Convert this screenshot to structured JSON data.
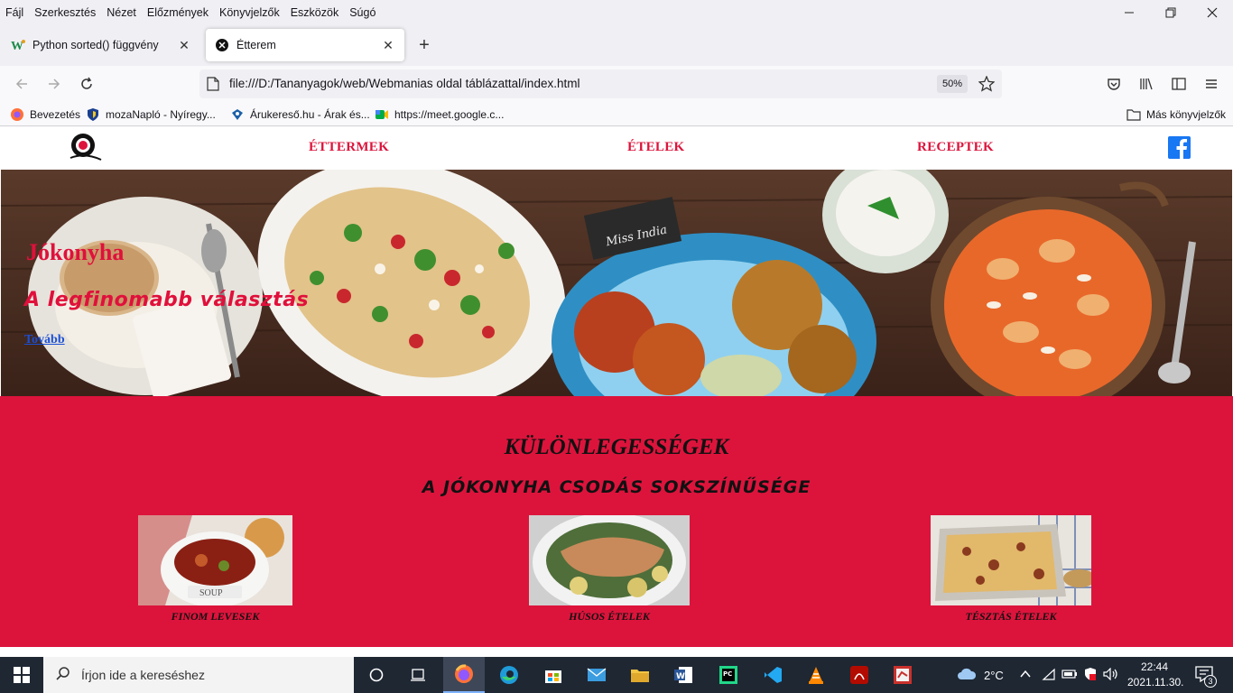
{
  "menubar": {
    "items": [
      "Fájl",
      "Szerkesztés",
      "Nézet",
      "Előzmények",
      "Könyvjelzők",
      "Eszközök",
      "Súgó"
    ]
  },
  "tabs": [
    {
      "label": "Python sorted() függvény",
      "icon": "w-icon"
    },
    {
      "label": "Étterem",
      "icon": "site-favicon"
    }
  ],
  "navbar": {
    "url": "file:///D:/Tananyagok/web/Webmanias oldal táblázattal/index.html",
    "zoom": "50%"
  },
  "bookmarks": {
    "items": [
      {
        "label": "Bevezetés",
        "icon": "firefox-icon"
      },
      {
        "label": "mozaNapló - Nyíregy...",
        "icon": "shield-icon"
      },
      {
        "label": "Árukereső.hu - Árak és...",
        "icon": "arukereso-icon"
      },
      {
        "label": "https://meet.google.c...",
        "icon": "meet-icon"
      }
    ],
    "other": "Más könyvjelzők"
  },
  "site": {
    "nav": [
      "ÉTTERMEK",
      "ÉTELEK",
      "RECEPTEK"
    ],
    "hero": {
      "title": "Jókonyha",
      "subtitle": "A legfinomabb választás",
      "link": "Tovább"
    },
    "special": {
      "title": "KÜLÖNLEGESSÉGEK",
      "subtitle": "A JÓKONYHA CSODÁS SOKSZÍNŰSÉGE",
      "cards": [
        {
          "caption": "FINOM LEVESEK"
        },
        {
          "caption": "HÚSOS ÉTELEK"
        },
        {
          "caption": "TÉSZTÁS ÉTELEK"
        }
      ]
    }
  },
  "taskbar": {
    "search_placeholder": "Írjon ide a kereséshez",
    "temperature": "2°C",
    "time": "22:44",
    "date": "2021.11.30.",
    "notifications": "3"
  },
  "colors": {
    "brand": "#dc143c",
    "taskbar": "#1f2733"
  }
}
